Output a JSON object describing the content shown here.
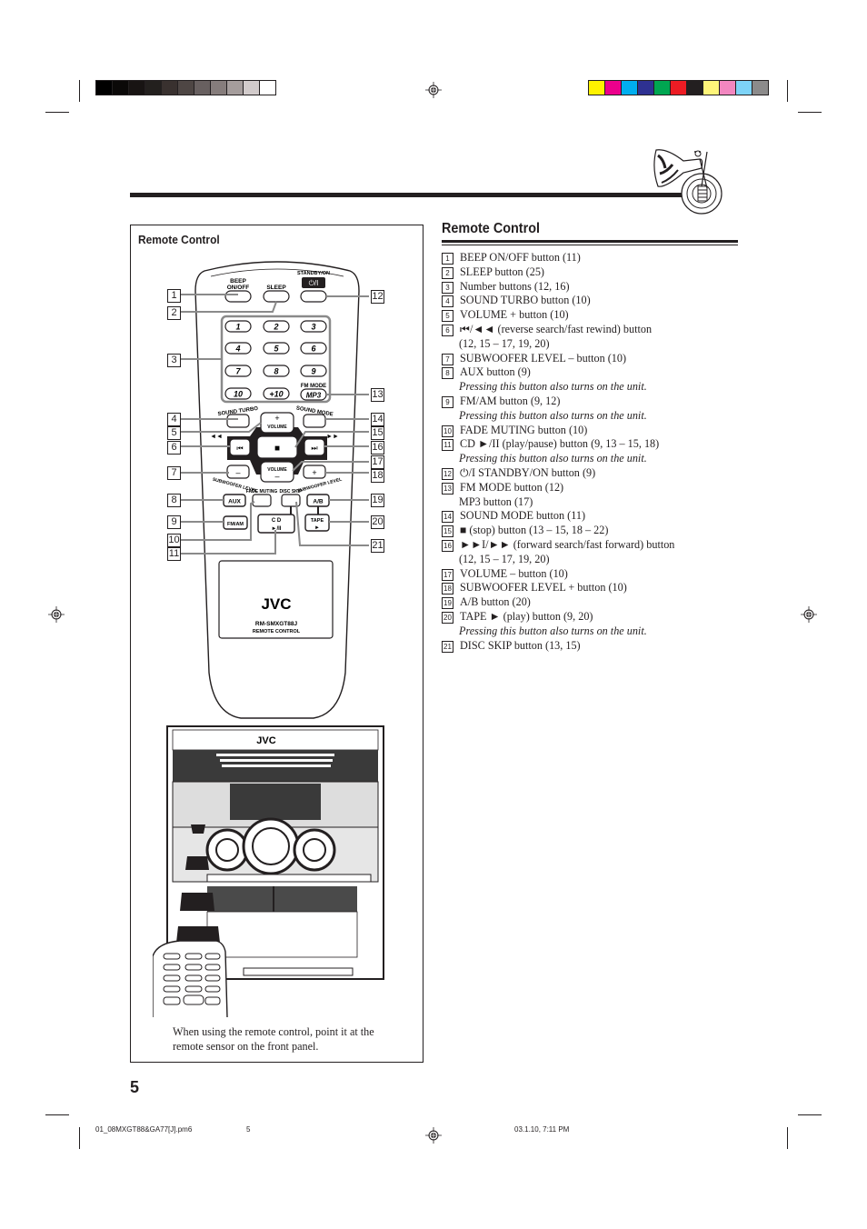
{
  "print_marks": {
    "grayscale_swatches": [
      "#000000",
      "#0b0908",
      "#181413",
      "#23201e",
      "#39312f",
      "#4e4644",
      "#686060",
      "#867d7c",
      "#a59d9c",
      "#d2cbcb",
      "#ffffff"
    ],
    "color_swatches": [
      "#fff200",
      "#ec008c",
      "#00aeef",
      "#2e3192",
      "#00a651",
      "#ed1c24",
      "#231f20",
      "#fff57a",
      "#f287c0",
      "#7dd3f7",
      "#8c8b8b"
    ]
  },
  "header": {
    "decoration_icon": "french-horn-icon"
  },
  "left_panel": {
    "title": "Remote Control",
    "remote": {
      "labels": {
        "beep": "BEEP",
        "on_off": "ON/OFF",
        "sleep": "SLEEP",
        "standby_on": "STANDBY/ON",
        "standby_symbol": "⏻/I",
        "numbers": [
          "1",
          "2",
          "3",
          "4",
          "5",
          "6",
          "7",
          "8",
          "9",
          "10",
          "+10"
        ],
        "fm_mode": "FM MODE",
        "mp3": "MP3",
        "sound_turbo": "SOUND TURBO",
        "sound_mode": "SOUND MODE",
        "volume": "VOLUME",
        "plus": "+",
        "minus": "–",
        "rew": "◄◄",
        "ffw": "►►",
        "prev": "⏮",
        "next": "⏭",
        "stop": "■",
        "subwoofer_level": "SUBWOOFER LEVEL",
        "fade_muting": "FADE MUTING",
        "disc_skip": "DISC SKIP",
        "aux": "AUX",
        "ab": "A/B",
        "fmam": "FM/AM",
        "cd": "C D",
        "play_pause": "►/II",
        "tape": "TAPE",
        "tape_play": "►",
        "brand": "JVC",
        "model": "RM-SMXGT88J",
        "remote_control": "REMOTE CONTROL"
      },
      "callouts": [
        "1",
        "2",
        "3",
        "4",
        "5",
        "6",
        "7",
        "8",
        "9",
        "10",
        "11",
        "12",
        "13",
        "14",
        "15",
        "16",
        "17",
        "18",
        "19",
        "20",
        "21"
      ]
    },
    "unit": {
      "brand": "JVC"
    },
    "caption": "When using the remote control, point it at the remote sensor on the front panel."
  },
  "right_panel": {
    "title": "Remote Control",
    "items": [
      {
        "num": "1",
        "lines": [
          "BEEP ON/OFF button (11)"
        ]
      },
      {
        "num": "2",
        "lines": [
          "SLEEP button (25)"
        ]
      },
      {
        "num": "3",
        "lines": [
          "Number buttons (12, 16)"
        ]
      },
      {
        "num": "4",
        "lines": [
          "SOUND TURBO button (10)"
        ]
      },
      {
        "num": "5",
        "lines": [
          "VOLUME + button (10)"
        ]
      },
      {
        "num": "6",
        "lines": [
          "⏮/◄◄ (reverse search/fast rewind) button",
          "(12, 15 – 17, 19, 20)"
        ]
      },
      {
        "num": "7",
        "lines": [
          "SUBWOOFER LEVEL – button (10)"
        ]
      },
      {
        "num": "8",
        "lines": [
          "AUX button (9)"
        ],
        "note": "Pressing this button also turns on the unit."
      },
      {
        "num": "9",
        "lines": [
          "FM/AM button (9, 12)"
        ],
        "note": "Pressing this button also turns on the unit."
      },
      {
        "num": "10",
        "lines": [
          "FADE MUTING button (10)"
        ]
      },
      {
        "num": "11",
        "lines": [
          "CD ►/II (play/pause) button (9, 13 – 15, 18)"
        ],
        "note": "Pressing this button also turns on the unit."
      },
      {
        "num": "12",
        "lines": [
          "⏻/I STANDBY/ON button (9)"
        ]
      },
      {
        "num": "13",
        "lines": [
          "FM MODE button (12)",
          "MP3 button (17)"
        ]
      },
      {
        "num": "14",
        "lines": [
          "SOUND MODE button (11)"
        ]
      },
      {
        "num": "15",
        "lines": [
          "■ (stop) button (13 – 15, 18 – 22)"
        ]
      },
      {
        "num": "16",
        "lines": [
          "►►I/►► (forward search/fast forward) button",
          "(12, 15 – 17, 19, 20)"
        ]
      },
      {
        "num": "17",
        "lines": [
          "VOLUME – button (10)"
        ]
      },
      {
        "num": "18",
        "lines": [
          "SUBWOOFER LEVEL + button (10)"
        ]
      },
      {
        "num": "19",
        "lines": [
          "A/B button (20)"
        ]
      },
      {
        "num": "20",
        "lines": [
          "TAPE ► (play) button (9, 20)"
        ],
        "note": "Pressing this button also turns on the unit."
      },
      {
        "num": "21",
        "lines": [
          "DISC SKIP button (13, 15)"
        ]
      }
    ]
  },
  "page_number": "5",
  "footer": {
    "filename": "01_08MXGT88&GA77[J].pm6",
    "page": "5",
    "datetime": "03.1.10, 7:11 PM"
  }
}
